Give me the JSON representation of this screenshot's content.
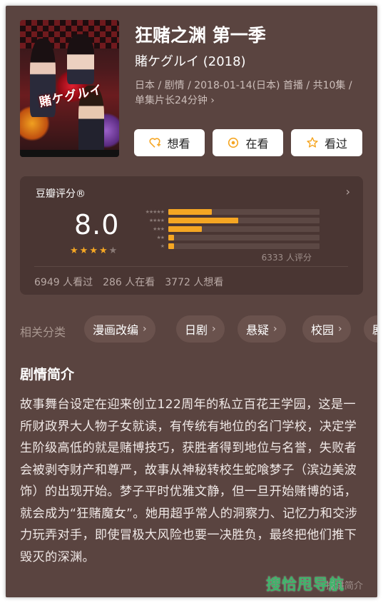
{
  "header": {
    "title": "狂赌之渊 第一季",
    "original_title": "賭ケグルイ (2018)",
    "meta": "日本 / 剧情 / 2018-01-14(日本) 首播 / 共10集 / 单集片长24分钟",
    "meta_chevron": "›"
  },
  "poster": {
    "title_text": "賭ケグルイ"
  },
  "actions": {
    "want_label": "想看",
    "watching_label": "在看",
    "watched_label": "看过",
    "accent_color": "#f5a623"
  },
  "rating": {
    "label": "豆瓣评分®",
    "score": "8.0",
    "score_stars": 4,
    "distribution": [
      {
        "stars": "★★★★★",
        "fraction": 0.29
      },
      {
        "stars": "★★★★",
        "fraction": 0.46
      },
      {
        "stars": "★★★",
        "fraction": 0.22
      },
      {
        "stars": "★★",
        "fraction": 0.04
      },
      {
        "stars": "★",
        "fraction": 0.04
      }
    ],
    "count_text": "6333 人评分",
    "stats": [
      "6949 人看过",
      "286 人在看",
      "3772 人想看"
    ]
  },
  "categories": {
    "label": "相关分类",
    "items": [
      "漫画改编",
      "日剧",
      "悬疑",
      "校园",
      "剧"
    ]
  },
  "synopsis": {
    "title": "剧情简介",
    "text": "故事舞台设定在迎来创立122周年的私立百花王学园，这是一所财政界大人物子女就读，有传统有地位的名门学校，决定学生阶级高低的就是赌博技巧，获胜者得到地位与名誉，失败者会被剥夺财产和尊严，故事从神秘转校生蛇喰梦子（滨边美波饰）的出现开始。梦子平时优雅文静，但一旦开始赌博的话，就会成为“狂赌魔女”。她用超乎常人的洞察力、记忆力和交涉力玩弄对手，即使冒极大风险也要一决胜负，最终把他们推下毁灭的深渊。",
    "footer": "提讲简介"
  },
  "watermark": "搜恰甩导航"
}
